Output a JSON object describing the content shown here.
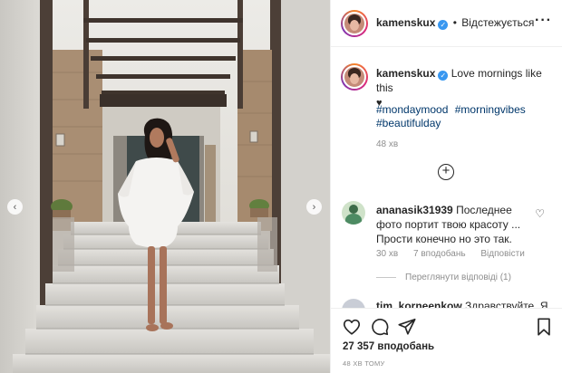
{
  "post": {
    "username": "kamenskux",
    "verified_mark": "✓",
    "separator": "•",
    "follow_state": "Відстежується",
    "more_icon": "ellipsis-icon"
  },
  "caption": {
    "username": "kamenskux",
    "text": "Love mornings like this",
    "emoji": "♥",
    "hashtags": [
      "#mondaymood",
      "#morningvibes",
      "#beautifulday"
    ],
    "time": "48 хв"
  },
  "load_more": "+",
  "comments": [
    {
      "username": "ananasik31939",
      "text": "Последнее фото портит твою красоту ... Прости конечно но это так.",
      "time": "30 хв",
      "likes": "7 вподобань",
      "reply": "Відповісти",
      "view_replies": "Переглянути відповіді (1)",
      "like_icon": "heart-outline-icon"
    },
    {
      "username": "tim_korneenkow",
      "text": "Здравствуйте. Я"
    }
  ],
  "actions": {
    "likes_count": "27 357 вподобань",
    "time_ago": "48 ХВ ТОМУ"
  },
  "colors": {
    "link": "#00376b",
    "verified": "#3897f0",
    "muted": "#8e8e8e",
    "text": "#262626"
  },
  "carousel": {
    "prev": "‹",
    "next": "›"
  }
}
